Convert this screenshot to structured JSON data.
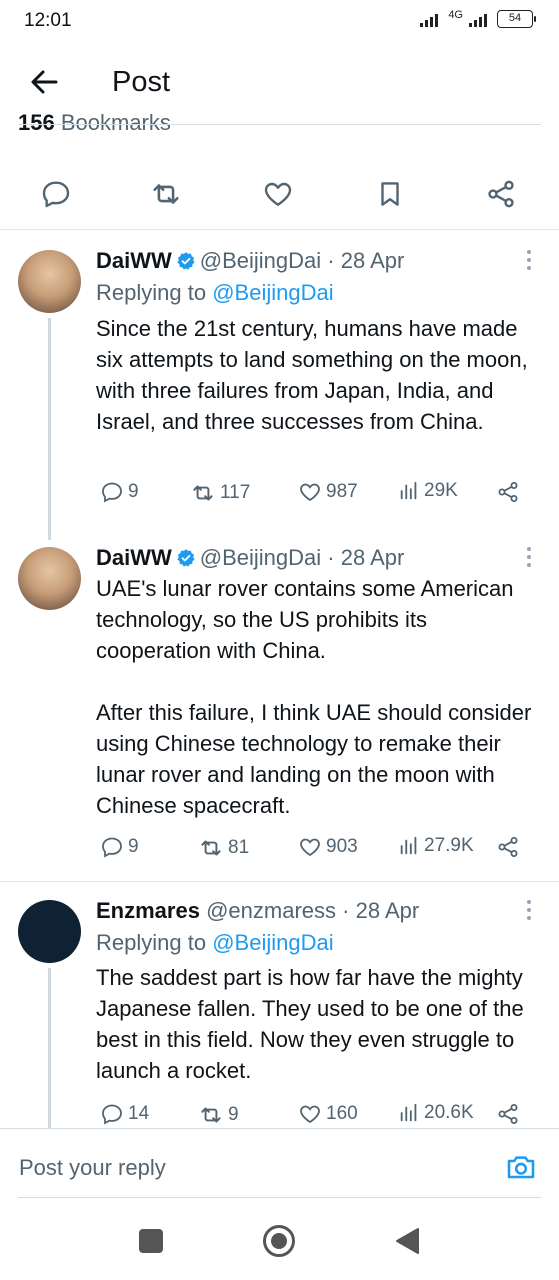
{
  "status": {
    "time": "12:01",
    "network": "4G",
    "battery": "54"
  },
  "header": {
    "title": "Post",
    "bookmarks_count": "156",
    "bookmarks_label": "Bookmarks"
  },
  "reply_bar": {
    "placeholder": "Post your reply"
  },
  "tweets": [
    {
      "name": "DaiWW",
      "handle": "@BeijingDai",
      "date": "· 28 Apr",
      "replying_label": "Replying to",
      "replying_to": "@BeijingDai",
      "body": "Since the 21st century, humans have made six attempts to land something on the moon, with three failures from Japan, India, and Israel, and three successes from China.",
      "replies": "9",
      "reposts": "117",
      "likes": "987",
      "views": "29K"
    },
    {
      "name": "DaiWW",
      "handle": "@BeijingDai",
      "date": "· 28 Apr",
      "body": "UAE's lunar rover contains some American technology, so the US prohibits its cooperation with China.\n\nAfter this failure, I think UAE should consider using Chinese technology to remake their lunar rover and landing on the moon with Chinese spacecraft.",
      "replies": "9",
      "reposts": "81",
      "likes": "903",
      "views": "27.9K"
    },
    {
      "name": "Enzmares",
      "handle": "@enzmaress",
      "date": "· 28 Apr",
      "replying_label": "Replying to",
      "replying_to": "@BeijingDai",
      "body": "The saddest part is how far have the mighty Japanese fallen. They used to be one of the best in this field. Now they even struggle to launch a rocket.",
      "replies": "14",
      "reposts": "9",
      "likes": "160",
      "views": "20.6K"
    }
  ],
  "colors": {
    "accent": "#1d9bf0",
    "text": "#0f1419",
    "secondary": "#536471",
    "border": "#d6dde3"
  }
}
